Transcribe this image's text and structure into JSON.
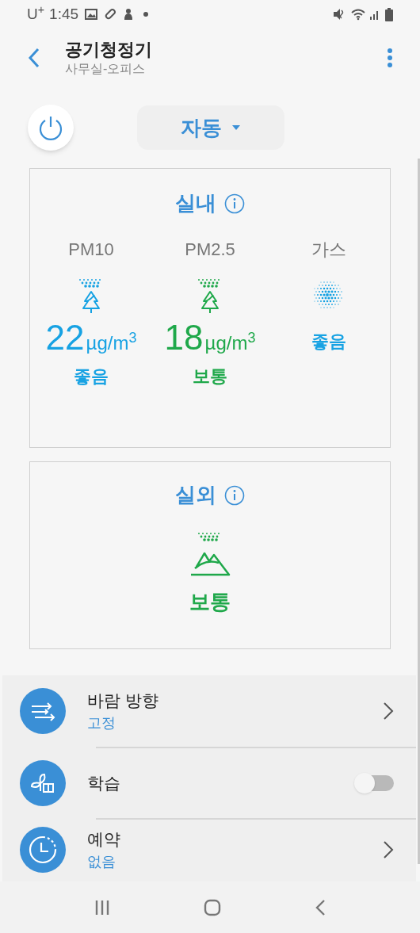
{
  "status_bar": {
    "carrier": "U$^{+}$",
    "time": "1:45"
  },
  "header": {
    "title": "공기청정기",
    "subtitle": "사무실-오피스"
  },
  "mode": {
    "label": "자동"
  },
  "indoor": {
    "title": "실내",
    "metrics": [
      {
        "kind": "particle",
        "name": "PM10",
        "value": "22",
        "unit": "µg/m$^{3}$",
        "status": "좋음",
        "color": "#17a2e3"
      },
      {
        "kind": "particle",
        "name": "PM2.5",
        "value": "18",
        "unit": "µg/m$^{3}$",
        "status": "보통",
        "color": "#1fa84a"
      },
      {
        "kind": "gas",
        "name": "가스",
        "status": "좋음",
        "color": "#17a2e3"
      }
    ]
  },
  "outdoor": {
    "title": "실외",
    "status": "보통",
    "color": "#1fa84a"
  },
  "settings": [
    {
      "kind": "link",
      "label": "바람 방향",
      "value": "고정"
    },
    {
      "kind": "toggle",
      "label": "학습",
      "on": false
    },
    {
      "kind": "link",
      "label": "예약",
      "value": "없음"
    }
  ]
}
